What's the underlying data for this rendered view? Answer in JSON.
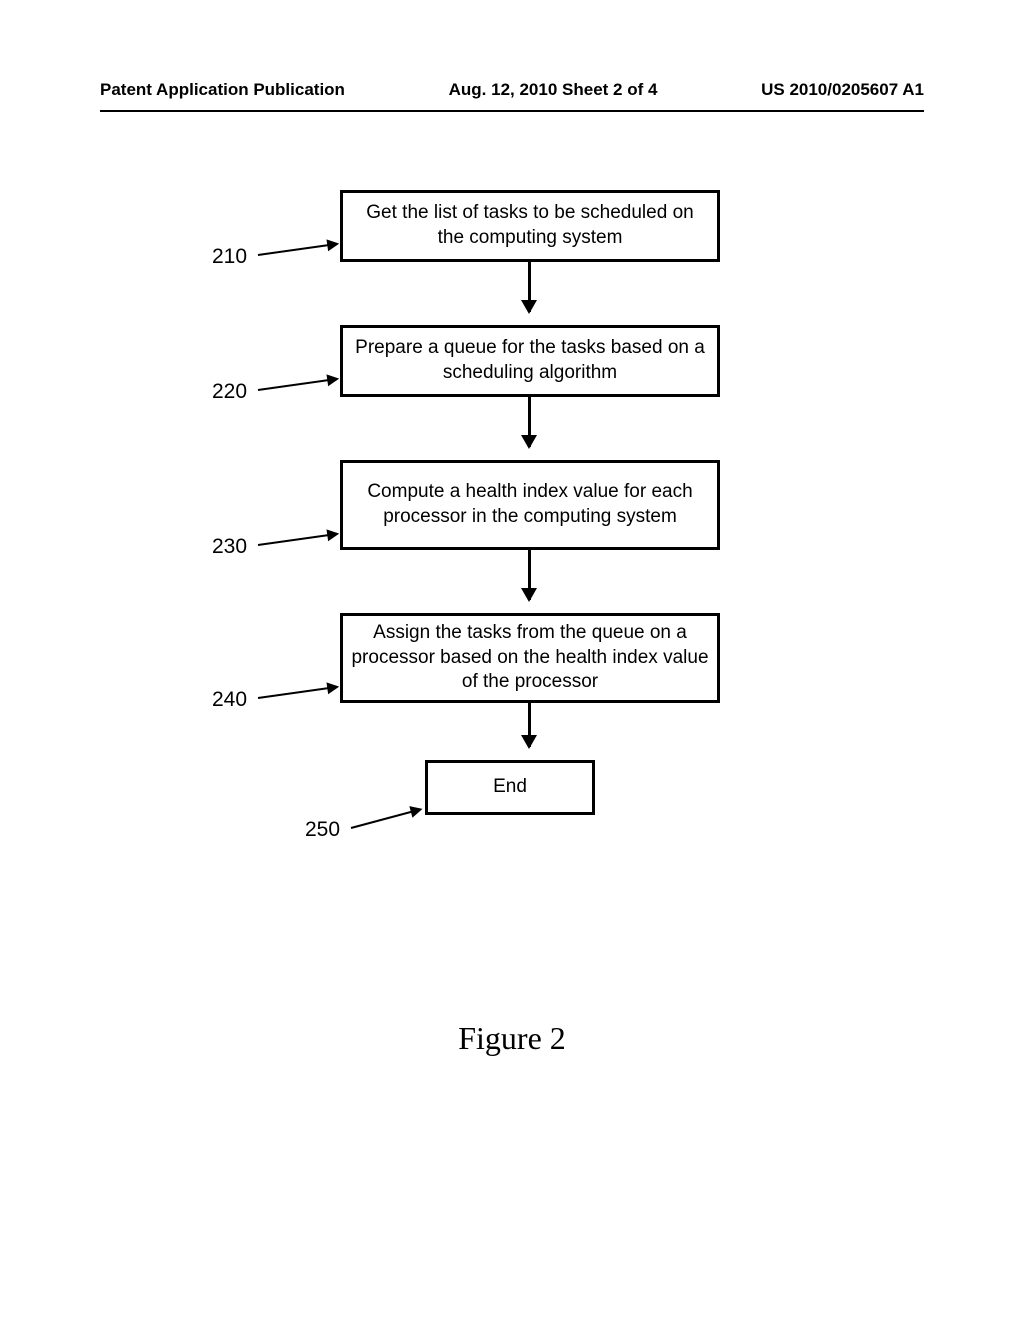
{
  "header": {
    "left": "Patent Application Publication",
    "center": "Aug. 12, 2010   Sheet 2 of 4",
    "right": "US 2010/0205607 A1"
  },
  "flowchart": {
    "steps": [
      {
        "ref": "210",
        "text": "Get the list of tasks to be scheduled on the computing system"
      },
      {
        "ref": "220",
        "text": "Prepare a queue for the tasks based on a scheduling algorithm"
      },
      {
        "ref": "230",
        "text": "Compute a health index value for each processor in the computing system"
      },
      {
        "ref": "240",
        "text": "Assign the tasks from the queue on a processor based on the health index value of the processor"
      },
      {
        "ref": "250",
        "text": "End"
      }
    ]
  },
  "caption": "Figure 2"
}
